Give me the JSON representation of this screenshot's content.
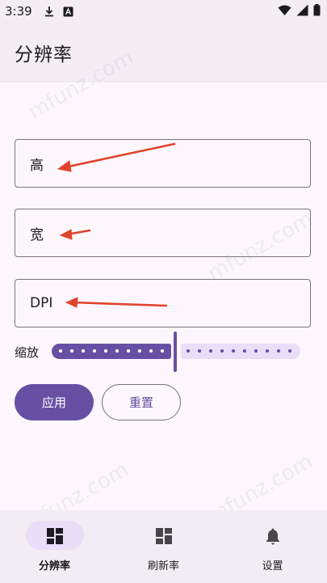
{
  "status_bar": {
    "time": "3:39",
    "icons": [
      "download-icon",
      "a-box-icon",
      "wifi-icon",
      "signal-icon",
      "battery-icon"
    ]
  },
  "app_bar": {
    "title": "分辨率"
  },
  "fields": {
    "height": {
      "label": "高"
    },
    "width": {
      "label": "宽"
    },
    "dpi": {
      "label": "DPI"
    }
  },
  "scale": {
    "label": "缩放",
    "level": 0.5
  },
  "buttons": {
    "apply": "应用",
    "reset": "重置"
  },
  "bottom_nav": {
    "items": [
      {
        "label": "分辨率",
        "icon": "dashboard-icon",
        "active": true
      },
      {
        "label": "刷新率",
        "icon": "dashboard-icon",
        "active": false
      },
      {
        "label": "设置",
        "icon": "bell-icon",
        "active": false
      }
    ]
  },
  "watermark": "mfunz.com",
  "colors": {
    "primary": "#6750a4",
    "primary_container": "#e8def8",
    "background": "#fdf7fd",
    "annotation_arrow": "#e0432b"
  }
}
